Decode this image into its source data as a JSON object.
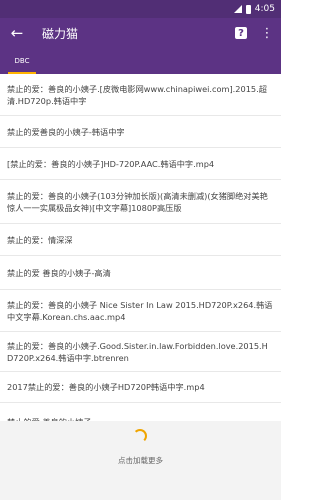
{
  "status": {
    "time": "4:05"
  },
  "appbar": {
    "back_icon": "back-arrow-icon",
    "title": "磁力猫",
    "help_label": "?",
    "more_icon": "more-vert-icon"
  },
  "tabs": [
    {
      "label": "DBC"
    }
  ],
  "results": [
    "禁止的爱：善良的小姨子.[皮微电影网www.chinapiwei.com].2015.超清.HD720p.韩语中字",
    "禁止的爱善良的小姨子-韩语中字",
    "[禁止的爱：善良的小姨子]HD-720P.AAC.韩语中字.mp4",
    "禁止的爱：善良的小姨子(103分钟加长版)(高清未删减)(女猪脚绝对美艳惊人一一实属极品女神)[中文字幕]1080P高压版",
    "禁止的爱：情深深",
    "禁止的爱 善良的小姨子-高清",
    "禁止的爱：善良的小姨子 Nice Sister In Law 2015.HD720P.x264.韩语中文字幕.Korean.chs.aac.mp4",
    "禁止的爱：善良的小姨子.Good.Sister.in.law.Forbidden.love.2015.HD720P.x264.韩语中字.btrenren",
    "2017禁止的爱：善良的小姨子HD720P韩语中字.mp4",
    "禁止的爱 善良的小姨子"
  ],
  "footer": {
    "load_more_label": "点击加载更多"
  },
  "colors": {
    "appbar": "#5c3384",
    "statusbar": "#512e75",
    "accent": "#ffb300"
  }
}
